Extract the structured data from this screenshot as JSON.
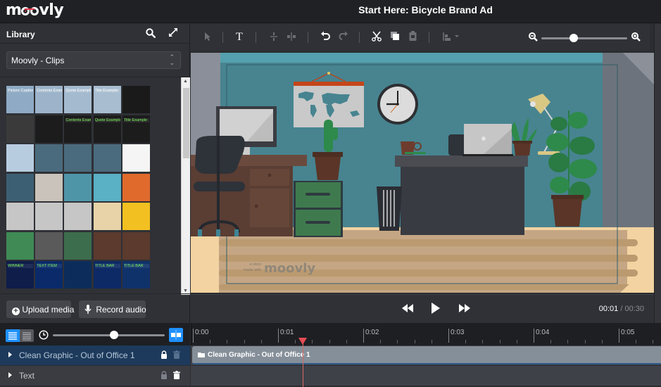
{
  "app": {
    "logo": "moovly",
    "project_title": "Start Here: Bicycle Brand Ad"
  },
  "library": {
    "title": "Library",
    "search_icon": "search-icon",
    "expand_icon": "expand-icon",
    "source_select": "Moovly - Clips",
    "thumbnails": [
      {
        "label": "Picture Caption",
        "bg": "#8eaac4"
      },
      {
        "label": "Contents Example",
        "bg": "#9cb3c9"
      },
      {
        "label": "Quote Example",
        "bg": "#a4bacf"
      },
      {
        "label": "Title Example",
        "bg": "#a8bdd0"
      },
      {
        "label": "",
        "bg": "#1a1a1a"
      },
      {
        "label": "",
        "bg": "#3a3a3a"
      },
      {
        "label": "",
        "bg": "#1c1c1c"
      },
      {
        "label": "Contents Example",
        "bg": "#1c1c1c"
      },
      {
        "label": "Quote Example",
        "bg": "#1c1c1c"
      },
      {
        "label": "Title Example",
        "bg": "#1c1c1c"
      },
      {
        "label": "",
        "bg": "#b8cce0"
      },
      {
        "label": "",
        "bg": "#4a6b7d"
      },
      {
        "label": "",
        "bg": "#4a6b7d"
      },
      {
        "label": "",
        "bg": "#4a6b7d"
      },
      {
        "label": "",
        "bg": "#f5f5f5"
      },
      {
        "label": "",
        "bg": "#3d5f73"
      },
      {
        "label": "",
        "bg": "#c9c3bb"
      },
      {
        "label": "",
        "bg": "#4f95a8"
      },
      {
        "label": "",
        "bg": "#5ab0c4"
      },
      {
        "label": "",
        "bg": "#e06a2c"
      },
      {
        "label": "",
        "bg": "#c6c6c6"
      },
      {
        "label": "",
        "bg": "#c6c6c6"
      },
      {
        "label": "",
        "bg": "#c6c6c6"
      },
      {
        "label": "",
        "bg": "#e8d3a8"
      },
      {
        "label": "",
        "bg": "#f2c020"
      },
      {
        "label": "",
        "bg": "#3f8a55"
      },
      {
        "label": "",
        "bg": "#5a5a5a"
      },
      {
        "label": "",
        "bg": "#3c6d4c"
      },
      {
        "label": "",
        "bg": "#5c3a2e"
      },
      {
        "label": "",
        "bg": "#5c3a2e"
      },
      {
        "label": "WINNER",
        "bg": "#0f1d4a"
      },
      {
        "label": "TEXT ITEM",
        "bg": "#0a2a6a"
      },
      {
        "label": "",
        "bg": "#0c2d5c"
      },
      {
        "label": "TITLE BAR",
        "bg": "#0e2a66"
      },
      {
        "label": "TITLE BAR",
        "bg": "#10326a"
      }
    ],
    "upload_button": "Upload media",
    "record_button": "Record audio"
  },
  "toolbar": {
    "tools": [
      "select-icon",
      "text-icon",
      "align-vertical-icon",
      "align-horizontal-icon",
      "undo-icon",
      "redo-icon",
      "cut-icon",
      "copy-icon",
      "paste-icon",
      "arrange-icon"
    ],
    "zoom_level": 0.38
  },
  "stage": {
    "watermark_small_1": "a story",
    "watermark_small_2": "made with",
    "watermark_logo": "moovly"
  },
  "player": {
    "current_time": "00:01",
    "separator": "/",
    "total_time": "00:30"
  },
  "timeline": {
    "scale_slider": 0.55,
    "ticks": [
      "0:00",
      "0:01",
      "0:02",
      "0:03",
      "0:04",
      "0:05"
    ],
    "playhead_time": 1.3,
    "layers": [
      {
        "name": "Clean Graphic - Out of Office 1",
        "selected": true,
        "clip_label": "Clean Graphic - Out of Office 1"
      },
      {
        "name": "Text",
        "selected": false,
        "clip_label": ""
      }
    ]
  },
  "colors": {
    "accent": "#1e90ff",
    "playhead": "#e84c55",
    "selected_layer": "#1d3a5c",
    "clip": "#858f99"
  }
}
